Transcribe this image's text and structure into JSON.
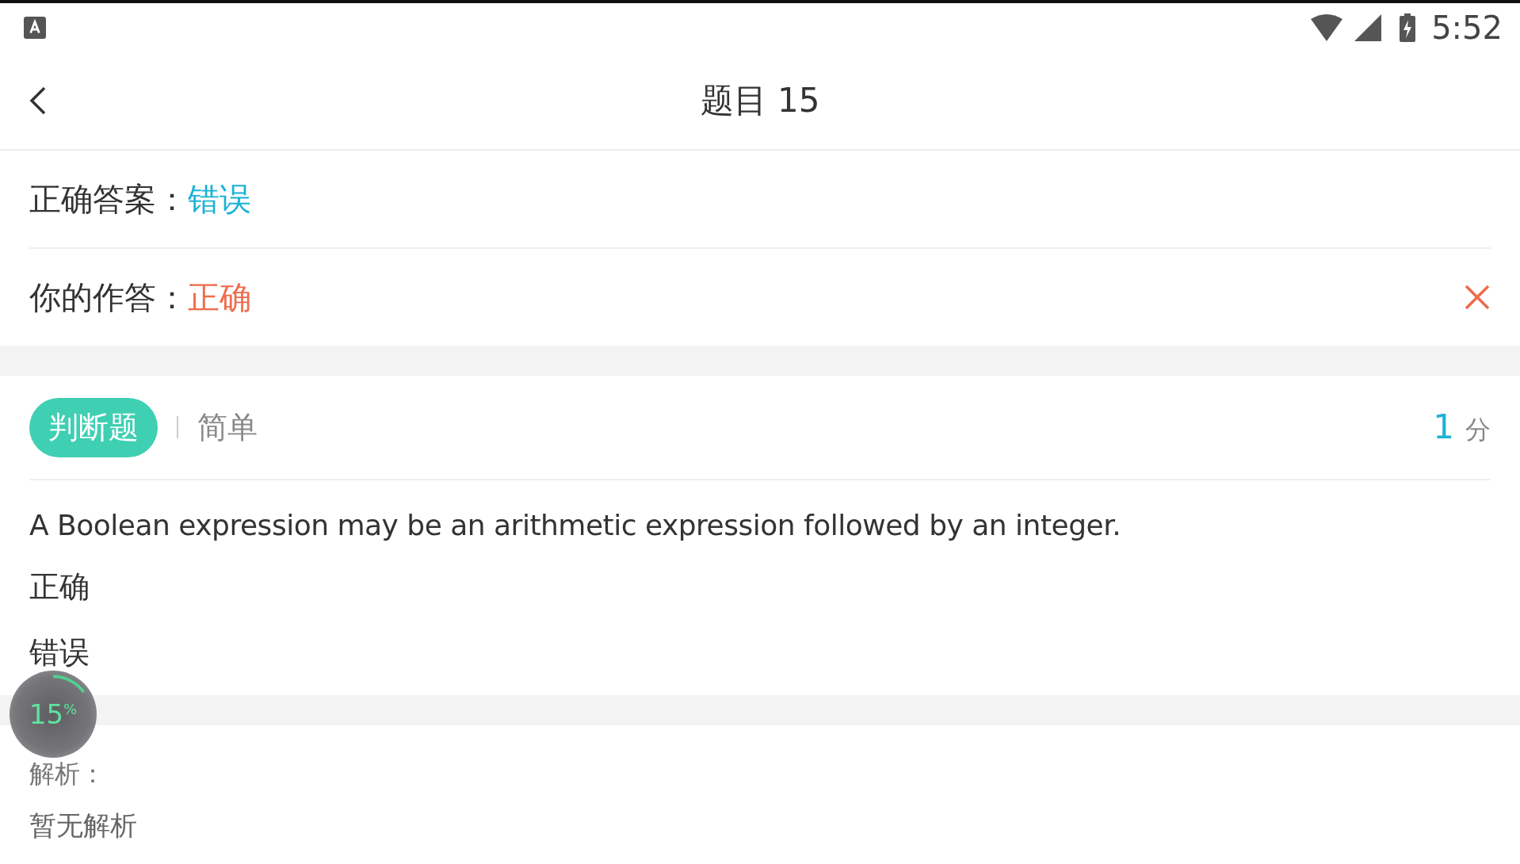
{
  "status_bar": {
    "time": "5:52"
  },
  "header": {
    "title": "题目 15"
  },
  "answers": [
    {
      "label": "正确答案：",
      "value": "错误",
      "kind": "correct",
      "wrong_mark": false
    },
    {
      "label": "你的作答：",
      "value": "正确",
      "kind": "user",
      "wrong_mark": true
    }
  ],
  "question": {
    "type_tag": "判断题",
    "difficulty": "简单",
    "score": "1",
    "score_unit": "分",
    "text": "A Boolean expression may be an arithmetic expression followed by an integer.",
    "options": [
      "正确",
      "错误"
    ]
  },
  "analysis": {
    "label": "解析：",
    "text": "暂无解析"
  },
  "floating_meter": {
    "reading": "15$^{%}$",
    "level": 0.15
  }
}
